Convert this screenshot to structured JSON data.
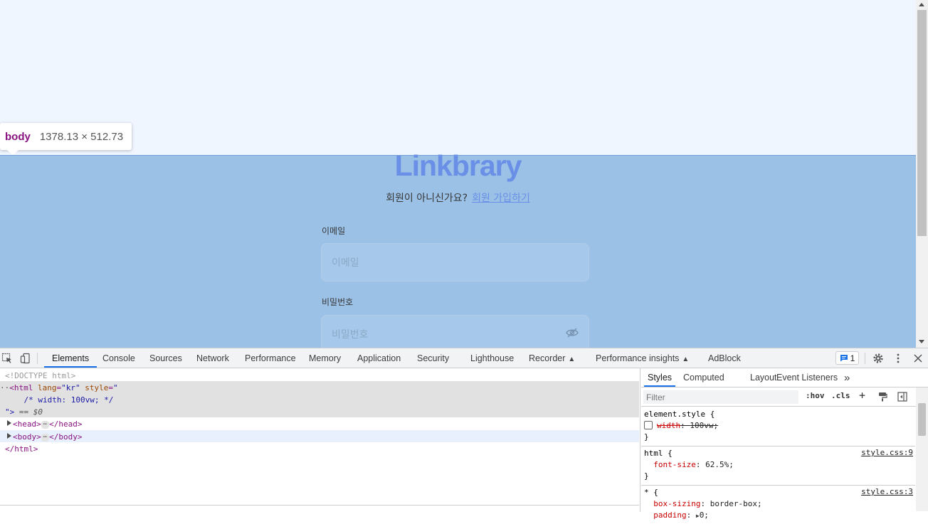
{
  "page": {
    "logo": "Linkbrary",
    "signup_prompt": "회원이 아니신가요?",
    "signup_link": "회원 가입하기",
    "email_label": "이메일",
    "email_placeholder": "이메일",
    "password_label": "비밀번호",
    "password_placeholder": "비밀번호"
  },
  "tooltip": {
    "tag": "body",
    "dims": "1378.13 × 512.73"
  },
  "devtools": {
    "tabs": [
      "Elements",
      "Console",
      "Sources",
      "Network",
      "Performance",
      "Memory",
      "Application",
      "Security",
      "Lighthouse",
      "Recorder",
      "Performance insights",
      "AdBlock"
    ],
    "active_tab": "Elements",
    "issues_count": "1",
    "dom": {
      "doctype": "<!DOCTYPE html>",
      "html_open_tag": "<html",
      "html_lang_attr": "lang",
      "html_lang_val": "\"kr\"",
      "html_style_attr": "style",
      "html_style_val": "\"",
      "html_comment": "    /* width: 100vw; */",
      "html_style_close": "\">",
      "selected_marker": " == $0",
      "head_open": "<head>",
      "head_close": "</head>",
      "body_open": "<body>",
      "body_close": "</body>",
      "html_close": "</html>",
      "ellipsis": "⋯"
    },
    "styles": {
      "tabs": [
        "Styles",
        "Computed",
        "Layout",
        "Event Listeners"
      ],
      "active_tab": "Styles",
      "more": "»",
      "filter_placeholder": "Filter",
      "hov": ":hov",
      "cls": ".cls",
      "plus": "+",
      "rules": {
        "element_selector": "element.style {",
        "element_prop": "width",
        "element_val": "100vw;",
        "html_selector": "html {",
        "html_prop": "font-size",
        "html_val": "62.5%;",
        "html_src": "style.css:9",
        "star_selector": "* {",
        "star_prop1": "box-sizing",
        "star_val1": "border-box;",
        "star_prop2": "padding",
        "star_val2": "0;",
        "star_src": "style.css:3",
        "close": "}"
      }
    }
  },
  "colors": {
    "overlay": "#9bc1e7",
    "logo": "#6a8fe6",
    "accent": "#1a73e8",
    "tag": "#881280"
  }
}
